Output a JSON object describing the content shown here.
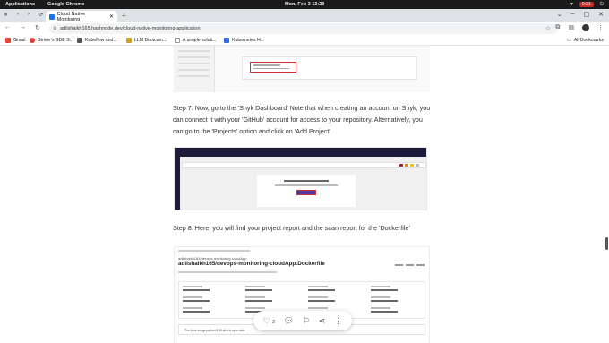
{
  "system_bar": {
    "menu": [
      "Applications",
      "Google Chrome"
    ],
    "clock": "Mon, Feb 3  13:29",
    "battery": "0:21"
  },
  "browser": {
    "tab_title": "Cloud Native Monitoring",
    "url": "adilshaikh165.hashnode.dev/cloud-native-monitoring-application",
    "bookmarks": [
      "Gmail",
      "Striver's SDE S...",
      "Kubeflow and...",
      "LLM Bootcam...",
      "A simple soluti...",
      "Kubernetes H..."
    ],
    "all_bookmarks": "All Bookmarks"
  },
  "article": {
    "step7": "Step 7. Now, go to the 'Snyk Dashboard' Note that when creating an account on Snyk, you can connect it with your 'GitHub' account for access to your repository. Alternatively, you can go to the 'Projects' option and click on 'Add Project'",
    "step8": "Step 8. Here, you will find your project report and the scan report for the 'Dockerfile'",
    "screenshot3": {
      "repo": "adilshaikh165/devops-monitoring-cloudApp",
      "title": "adilshaikh165/devops-monitoring-cloudApp:Dockerfile",
      "issue": "The base image python:3.10-slim is up to date"
    }
  },
  "action_bar": {
    "likes": "2"
  },
  "colors": {
    "accent": "#1a73e8",
    "snyk_dark": "#1d1b3a",
    "highlight": "#d32f2f"
  }
}
